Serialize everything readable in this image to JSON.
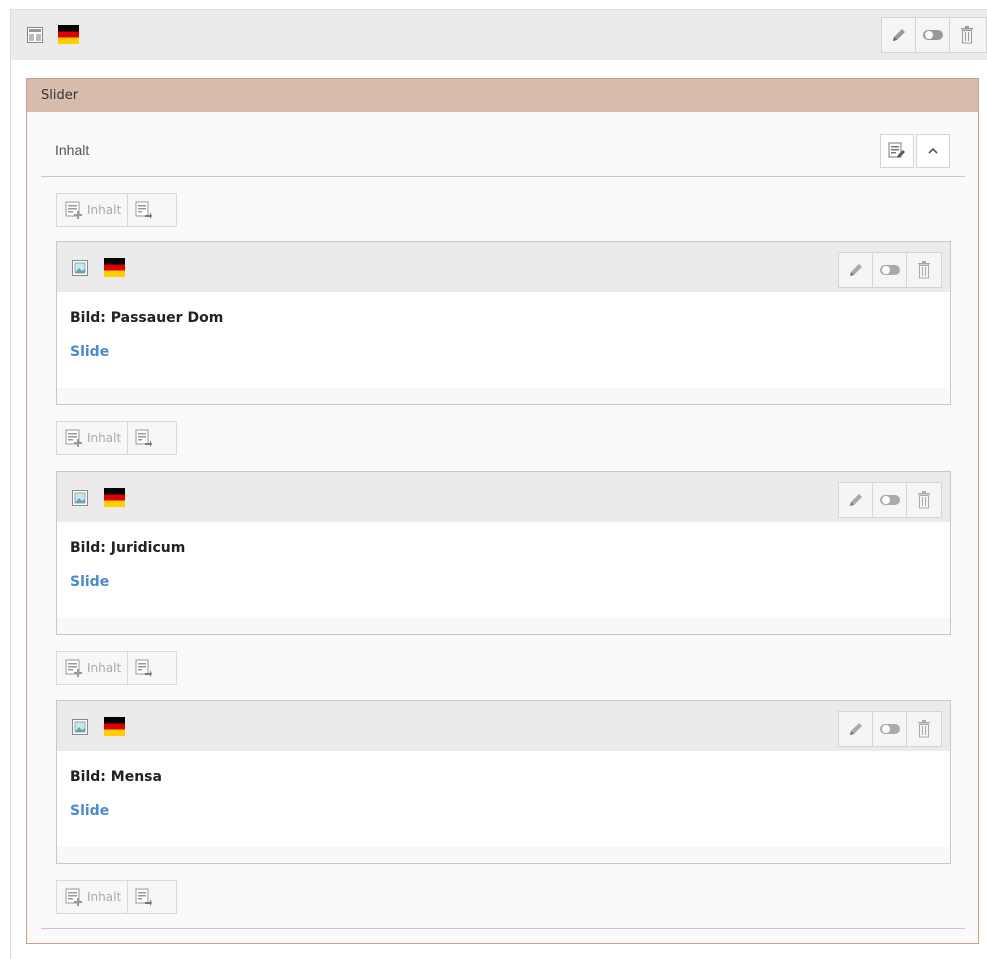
{
  "top_element": {
    "content_type_icon": "layout-icon",
    "language_flag": "germany-flag-icon",
    "actions": [
      "pencil-icon",
      "toggle-icon",
      "trash-icon"
    ]
  },
  "slider": {
    "title": "Slider",
    "column_label": "Inhalt",
    "column_actions": [
      "edit-column-icon",
      "chevron-up-icon"
    ],
    "new_content_label": "Inhalt",
    "items": [
      {
        "header_label": "Bild: Passauer Dom",
        "link_text": "Slide",
        "type_icon": "image-icon",
        "flag": "germany-flag-icon"
      },
      {
        "header_label": "Bild: Juridicum",
        "link_text": "Slide",
        "type_icon": "image-icon",
        "flag": "germany-flag-icon"
      },
      {
        "header_label": "Bild: Mensa",
        "link_text": "Slide",
        "type_icon": "image-icon",
        "flag": "germany-flag-icon"
      }
    ]
  },
  "colors": {
    "slider_header": "#d7bcac",
    "slider_border": "#c9a08b",
    "link": "#4a8bd0",
    "header_bg": "#ebebeb"
  }
}
